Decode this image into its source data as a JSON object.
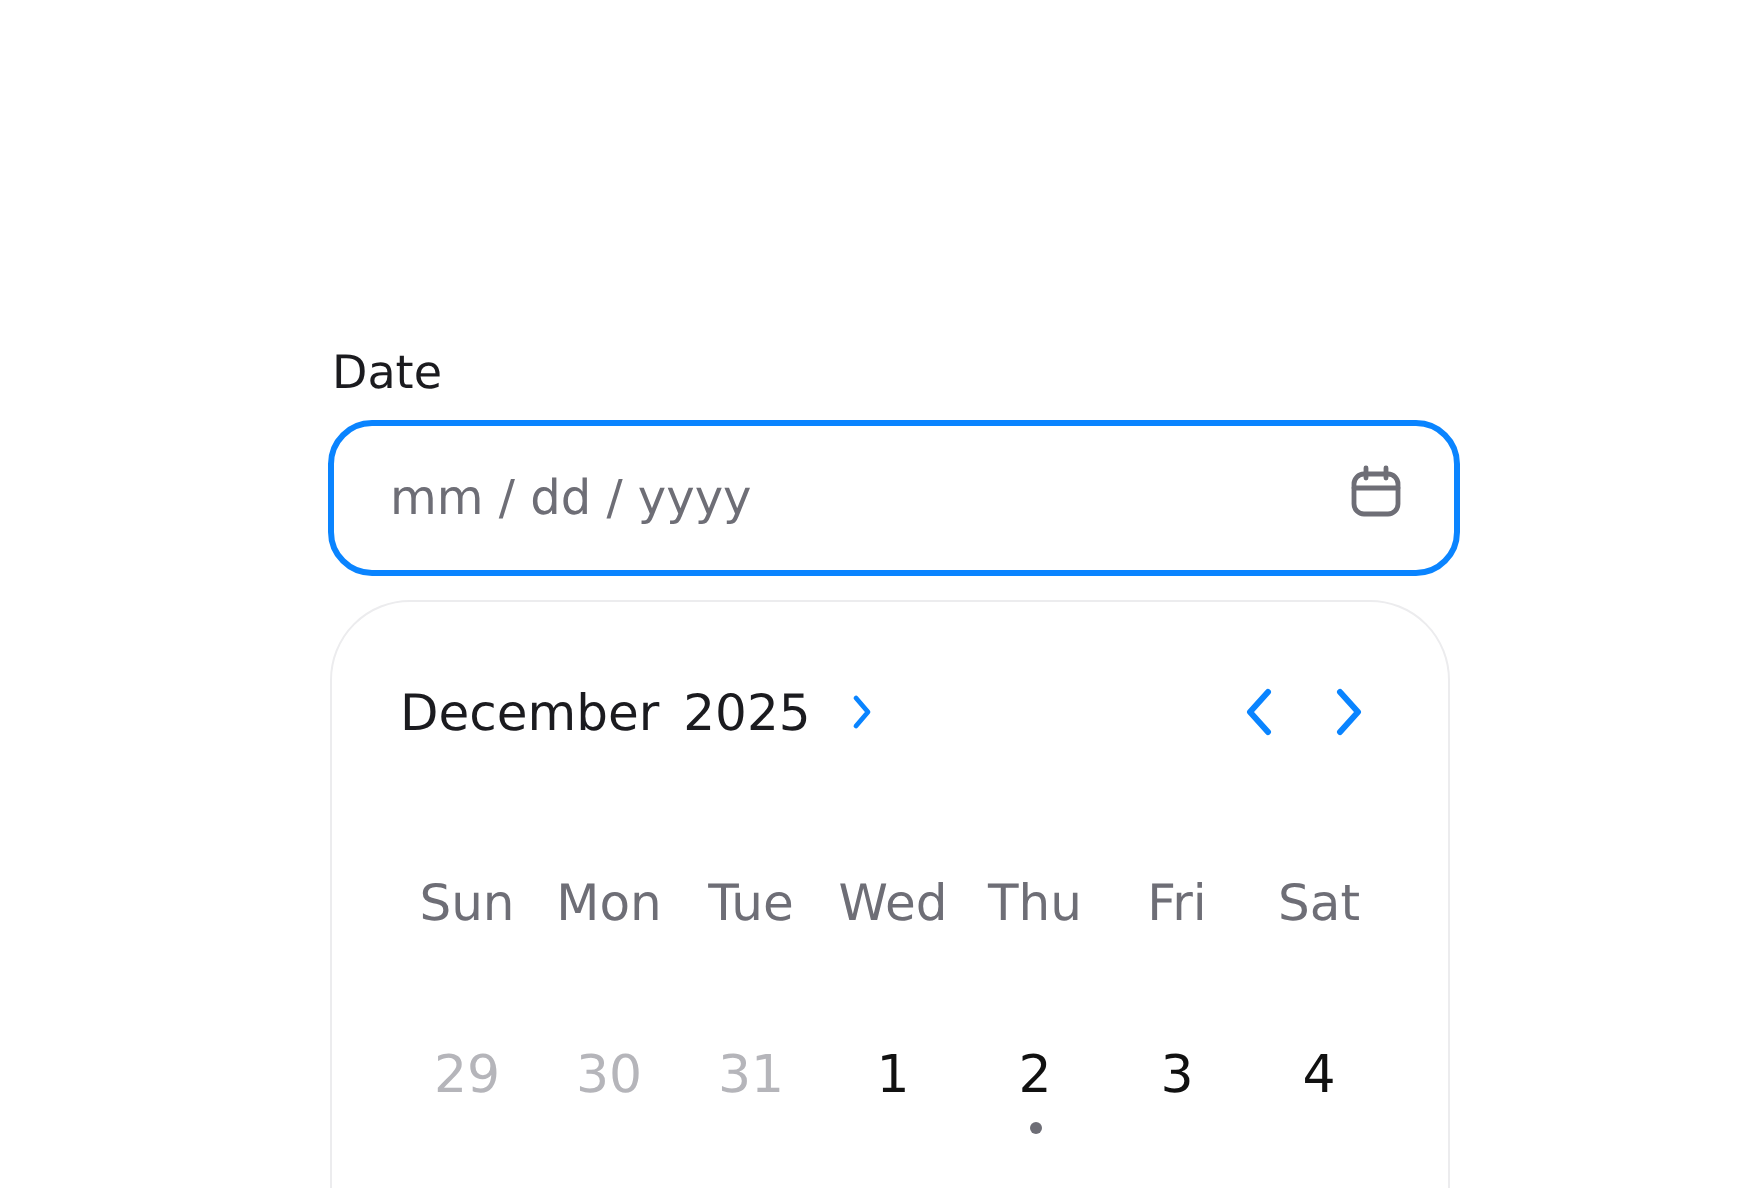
{
  "field": {
    "label": "Date",
    "placeholder": "mm / dd / yyyy",
    "focused": true
  },
  "calendar": {
    "month": "December",
    "year": "2025",
    "weekdays": [
      "Sun",
      "Mon",
      "Tue",
      "Wed",
      "Thu",
      "Fri",
      "Sat"
    ],
    "days": [
      {
        "label": "29",
        "outside": true,
        "today": false
      },
      {
        "label": "30",
        "outside": true,
        "today": false
      },
      {
        "label": "31",
        "outside": true,
        "today": false
      },
      {
        "label": "1",
        "outside": false,
        "today": false
      },
      {
        "label": "2",
        "outside": false,
        "today": true
      },
      {
        "label": "3",
        "outside": false,
        "today": false
      },
      {
        "label": "4",
        "outside": false,
        "today": false
      }
    ]
  }
}
